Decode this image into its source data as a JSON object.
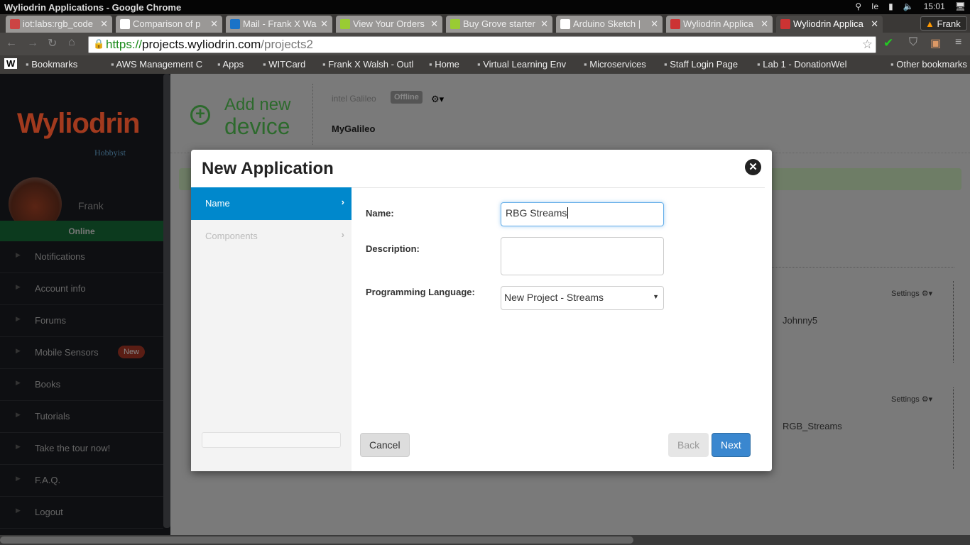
{
  "window": {
    "title": "Wyliodrin Applications - Google Chrome",
    "time": "15:01",
    "user": "Frank"
  },
  "tabs": [
    {
      "label": "iot:labs:rgb_code",
      "color": "#c44"
    },
    {
      "label": "Comparison of p",
      "color": "#fff"
    },
    {
      "label": "Mail - Frank X Wa",
      "color": "#1a73c8"
    },
    {
      "label": "View Your Orders",
      "color": "#9c3"
    },
    {
      "label": "Buy Grove starter",
      "color": "#9c3"
    },
    {
      "label": "Arduino Sketch |",
      "color": "#fff"
    },
    {
      "label": "Wyliodrin Applica",
      "color": "#c33"
    },
    {
      "label": "Wyliodrin Applica",
      "color": "#c33",
      "active": true
    }
  ],
  "address": {
    "scheme": "https://",
    "host": "projects.wyliodrin.com",
    "path": "/projects2"
  },
  "bookmarks": [
    "Bookmarks",
    "AWS Management C",
    "Apps",
    "WITCard",
    "Frank X Walsh - Outl",
    "Home",
    "Virtual Learning Env",
    "Microservices",
    "Staff Login Page",
    "Lab 1 - DonationWel",
    "Other bookmarks"
  ],
  "sidebar": {
    "logo": "Wyliodrin",
    "plan": "Hobbyist",
    "username": "Frank",
    "status": "Online",
    "items": [
      {
        "label": "Notifications"
      },
      {
        "label": "Account info"
      },
      {
        "label": "Forums"
      },
      {
        "label": "Mobile Sensors",
        "badge": "New"
      },
      {
        "label": "Books"
      },
      {
        "label": "Tutorials"
      },
      {
        "label": "Take the tour now!"
      },
      {
        "label": "F.A.Q."
      },
      {
        "label": "Logout"
      }
    ]
  },
  "main": {
    "add_device_line1": "Add new",
    "add_device_line2": "device",
    "device_brand": "intel Galileo",
    "device_status": "Offline",
    "device_name": "MyGalileo",
    "projects": [
      {
        "name": "Johnny5",
        "settings": "Settings"
      },
      {
        "name": "RGB_Streams",
        "settings": "Settings"
      }
    ]
  },
  "modal": {
    "title": "New Application",
    "steps": [
      {
        "label": "Name",
        "active": true
      },
      {
        "label": "Components"
      }
    ],
    "name_label": "Name:",
    "name_value": "RBG Streams",
    "description_label": "Description:",
    "description_value": "",
    "language_label": "Programming Language:",
    "language_value": "New Project - Streams",
    "cancel": "Cancel",
    "back": "Back",
    "next": "Next"
  },
  "colors": {
    "accent": "#0088cc",
    "online": "#1f8a3c",
    "brand": "#c0392b",
    "badge": "#c0392b"
  }
}
